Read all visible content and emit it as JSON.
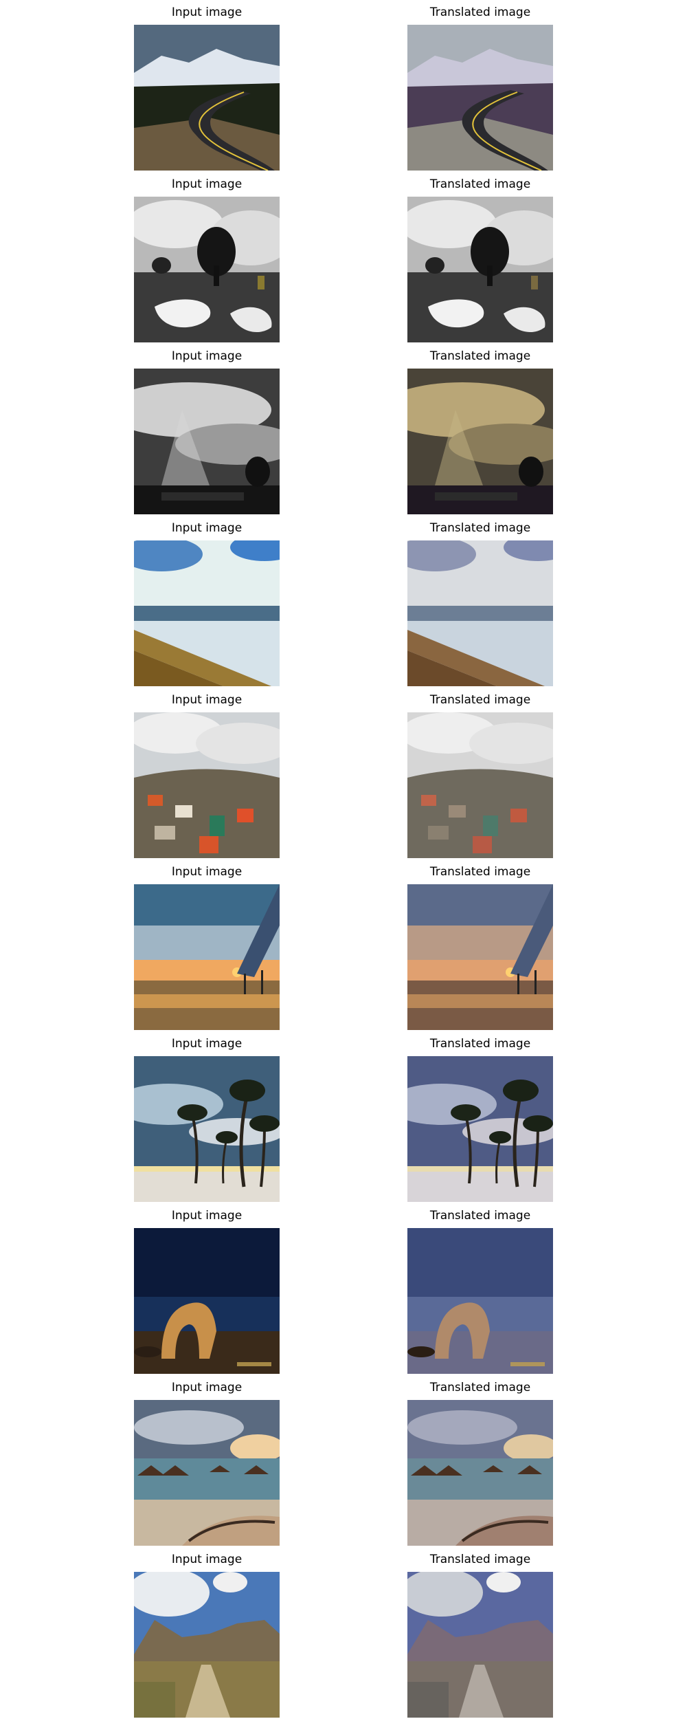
{
  "rows": [
    {
      "input_title": "Input image",
      "output_title": "Translated image",
      "scene": "mountain-road"
    },
    {
      "input_title": "Input image",
      "output_title": "Translated image",
      "scene": "tree-puddles-bw"
    },
    {
      "input_title": "Input image",
      "output_title": "Translated image",
      "scene": "sunrays-clouds"
    },
    {
      "input_title": "Input image",
      "output_title": "Translated image",
      "scene": "beach-boardwalk"
    },
    {
      "input_title": "Input image",
      "output_title": "Translated image",
      "scene": "city-fisheye"
    },
    {
      "input_title": "Input image",
      "output_title": "Translated image",
      "scene": "pier-sunset"
    },
    {
      "input_title": "Input image",
      "output_title": "Translated image",
      "scene": "palm-trees"
    },
    {
      "input_title": "Input image",
      "output_title": "Translated image",
      "scene": "rock-arch-night"
    },
    {
      "input_title": "Input image",
      "output_title": "Translated image",
      "scene": "overwater-bungalows"
    },
    {
      "input_title": "Input image",
      "output_title": "Translated image",
      "scene": "valley-path"
    }
  ]
}
